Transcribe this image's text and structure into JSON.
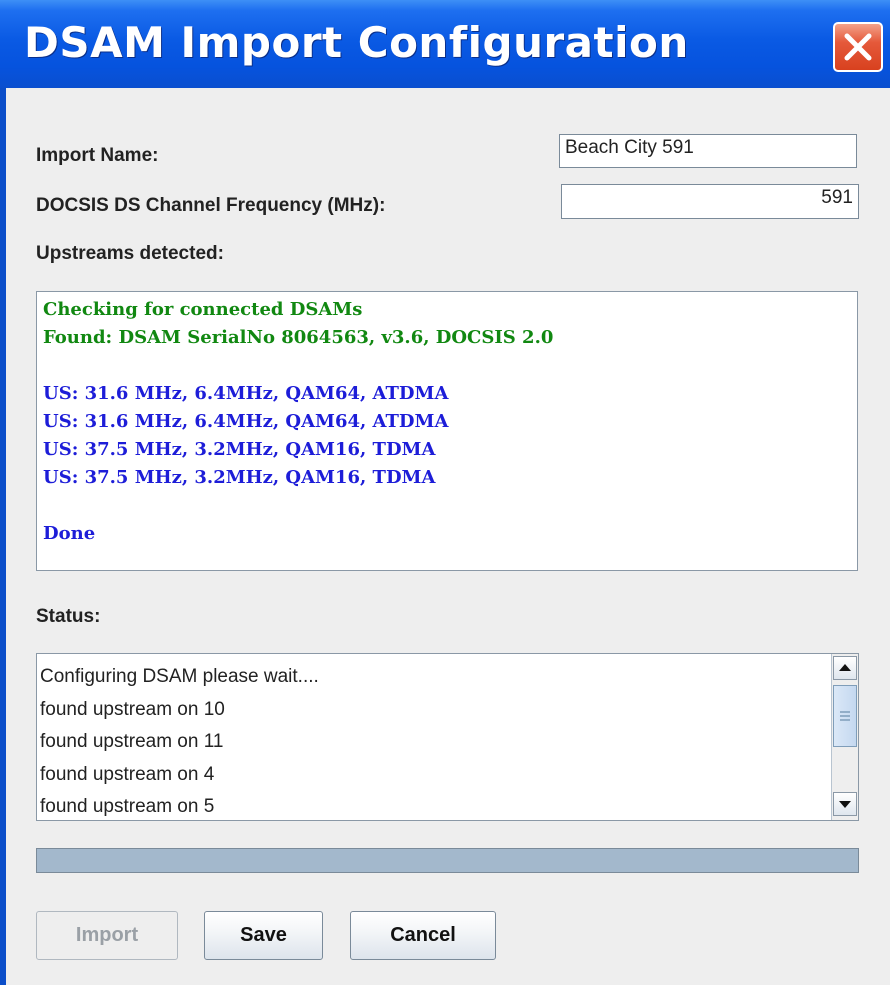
{
  "window": {
    "title": "DSAM Import Configuration"
  },
  "form": {
    "import_name_label": "Import Name:",
    "import_name_value": "Beach City 591",
    "frequency_label": "DOCSIS DS Channel Frequency (MHz):",
    "frequency_value": "591",
    "upstreams_label": "Upstreams detected:"
  },
  "output": {
    "lines": [
      {
        "text": "Checking for connected DSAMs",
        "color": "green"
      },
      {
        "text": "Found: DSAM SerialNo 8064563, v3.6, DOCSIS 2.0",
        "color": "green"
      },
      {
        "text": "",
        "color": "blue"
      },
      {
        "text": "US: 31.6 MHz, 6.4MHz, QAM64, ATDMA",
        "color": "blue"
      },
      {
        "text": "US: 31.6 MHz, 6.4MHz, QAM64, ATDMA",
        "color": "blue"
      },
      {
        "text": "US: 37.5 MHz, 3.2MHz, QAM16, TDMA",
        "color": "blue"
      },
      {
        "text": "US: 37.5 MHz, 3.2MHz, QAM16, TDMA",
        "color": "blue"
      },
      {
        "text": "",
        "color": "blue"
      },
      {
        "text": "Done",
        "color": "blue"
      }
    ]
  },
  "status": {
    "label": "Status:",
    "lines": [
      "Configuring DSAM please wait....",
      "found upstream on 10",
      "found upstream on 11",
      "found upstream on 4",
      "found upstream on 5"
    ]
  },
  "buttons": {
    "import": "Import",
    "save": "Save",
    "cancel": "Cancel"
  },
  "colors": {
    "green_text": "#118811",
    "blue_text": "#1d1dd8",
    "titlebar": "#0653de",
    "close_button": "#d8411f"
  },
  "icons": {
    "close": "close-icon",
    "scroll_up": "arrow-up-icon",
    "scroll_down": "arrow-down-icon",
    "grip": "scroll-grip-icon"
  }
}
